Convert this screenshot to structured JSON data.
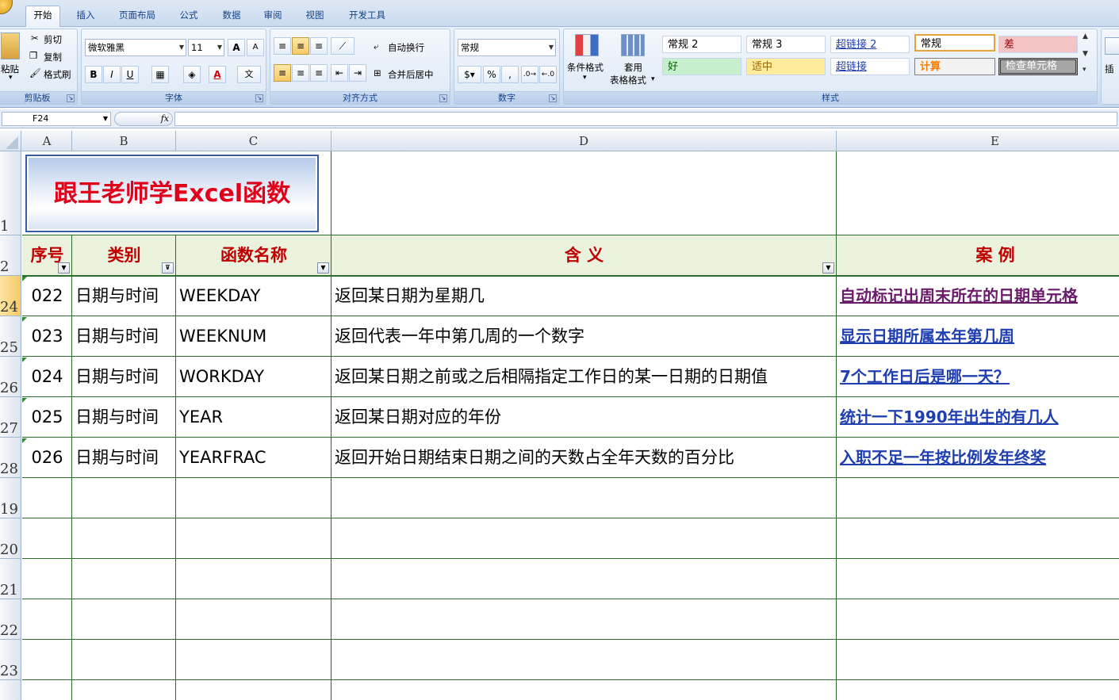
{
  "ribbon": {
    "tabs": [
      "开始",
      "插入",
      "页面布局",
      "公式",
      "数据",
      "审阅",
      "视图",
      "开发工具"
    ],
    "clipboard": {
      "paste": "粘贴",
      "cut": "剪切",
      "copy": "复制",
      "format_painter": "格式刷",
      "label": "剪贴板"
    },
    "font": {
      "name": "微软雅黑",
      "size": "11",
      "grow": "A",
      "shrink": "A",
      "bold": "B",
      "italic": "I",
      "underline": "U",
      "font_color": "A",
      "phonetic": "文",
      "label": "字体"
    },
    "alignment": {
      "wrap_text": "自动换行",
      "merge_center": "合并后居中",
      "label": "对齐方式"
    },
    "number": {
      "format": "常规",
      "percent": "%",
      "comma": ",",
      "label": "数字"
    },
    "styles": {
      "conditional_format": "条件格式",
      "table_format_1": "套用",
      "table_format_2": "表格格式",
      "label": "样式",
      "cells": [
        "常规 2",
        "常规 3",
        "超链接 2",
        "常规",
        "差",
        "好",
        "适中",
        "超链接",
        "计算",
        "检查单元格"
      ]
    },
    "right_label": "插"
  },
  "formula_bar": {
    "name_box": "F24",
    "fx": "fx",
    "formula": ""
  },
  "columns": [
    "A",
    "B",
    "C",
    "D",
    "E"
  ],
  "rows": [
    "1",
    "2",
    "24",
    "25",
    "26",
    "27",
    "28",
    "19",
    "20",
    "21",
    "22",
    "23"
  ],
  "banner": "跟王老师学Excel函数",
  "headers": [
    "序号",
    "类别",
    "函数名称",
    "含 义",
    "案 例"
  ],
  "table": [
    {
      "no": "022",
      "category": "日期与时间",
      "function": "WEEKDAY",
      "meaning": "返回某日期为星期几",
      "example": "自动标记出周末所在的日期单元格"
    },
    {
      "no": "023",
      "category": "日期与时间",
      "function": "WEEKNUM",
      "meaning": "返回代表一年中第几周的一个数字",
      "example": "显示日期所属本年第几周"
    },
    {
      "no": "024",
      "category": "日期与时间",
      "function": "WORKDAY",
      "meaning": "返回某日期之前或之后相隔指定工作日的某一日期的日期值",
      "example": "7个工作日后是哪一天？"
    },
    {
      "no": "025",
      "category": "日期与时间",
      "function": "YEAR",
      "meaning": "返回某日期对应的年份",
      "example": "统计一下1990年出生的有几人"
    },
    {
      "no": "026",
      "category": "日期与时间",
      "function": "YEARFRAC",
      "meaning": "返回开始日期结束日期之间的天数占全年天数的百分比",
      "example": "入职不足一年按比例发年终奖"
    }
  ],
  "colors": {
    "header_text": "#c00000",
    "header_fill": "#eaf1dd",
    "link": "#1f3fb0",
    "visited_link": "#6a1b6a",
    "banner_text": "#e0001a",
    "grid": "#2e6b2e"
  }
}
